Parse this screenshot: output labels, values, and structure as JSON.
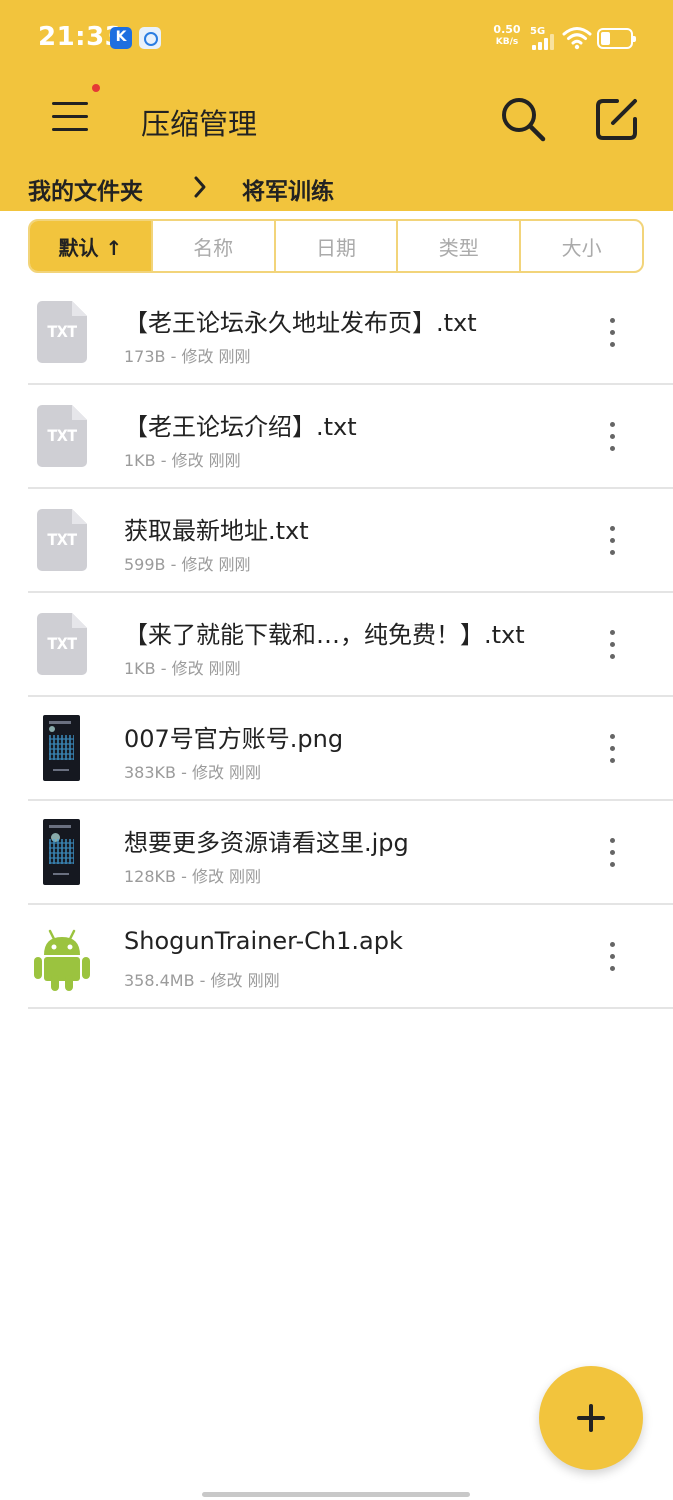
{
  "status_bar": {
    "time": "21:33",
    "net_speed_value": "0.50",
    "net_speed_unit": "KB/s",
    "network_type": "5G",
    "icons": [
      "k-app-icon",
      "cloud-app-icon",
      "signal-icon",
      "wifi-icon",
      "battery-icon"
    ]
  },
  "header": {
    "title": "压缩管理",
    "menu_icon": "hamburger-menu-icon",
    "search_icon": "search-icon",
    "edit_icon": "edit-icon",
    "notification_dot_color": "#e53935"
  },
  "breadcrumb": {
    "items": [
      "我的文件夹",
      "将军训练"
    ],
    "separator_icon": "chevron-right-icon"
  },
  "sort_tabs": [
    {
      "label": "默认 ↑",
      "active": true
    },
    {
      "label": "名称",
      "active": false
    },
    {
      "label": "日期",
      "active": false
    },
    {
      "label": "类型",
      "active": false
    },
    {
      "label": "大小",
      "active": false
    }
  ],
  "files": [
    {
      "name": "【老王论坛永久地址发布页】.txt",
      "meta": "173B - 修改 刚刚",
      "icon": "txt-file-icon",
      "icon_label": "TXT"
    },
    {
      "name": "【老王论坛介绍】.txt",
      "meta": "1KB - 修改 刚刚",
      "icon": "txt-file-icon",
      "icon_label": "TXT"
    },
    {
      "name": "获取最新地址.txt",
      "meta": "599B - 修改 刚刚",
      "icon": "txt-file-icon",
      "icon_label": "TXT"
    },
    {
      "name": "【来了就能下载和…，纯免费！】.txt",
      "meta": "1KB - 修改 刚刚",
      "icon": "txt-file-icon",
      "icon_label": "TXT"
    },
    {
      "name": "007号官方账号.png",
      "meta": "383KB - 修改 刚刚",
      "icon": "image-thumbnail"
    },
    {
      "name": "想要更多资源请看这里.jpg",
      "meta": "128KB - 修改 刚刚",
      "icon": "image-thumbnail"
    },
    {
      "name": "ShogunTrainer-Ch1.apk",
      "meta": "358.4MB - 修改 刚刚",
      "icon": "android-apk-icon"
    }
  ],
  "fab": {
    "icon": "plus-icon"
  },
  "colors": {
    "accent": "#f2c43d",
    "accent_border": "#f2d47a",
    "meta_text": "#9b9b9b",
    "txt_icon": "#cfcfd4",
    "android_green": "#9bc33f"
  }
}
